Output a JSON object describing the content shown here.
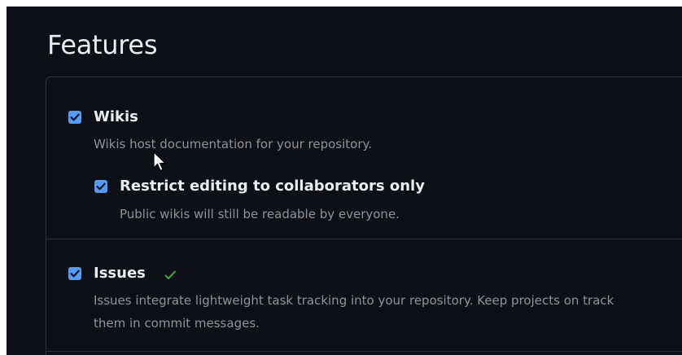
{
  "section": {
    "title": "Features"
  },
  "features": {
    "wikis": {
      "label": "Wikis",
      "checked": true,
      "description": "Wikis host documentation for your repository."
    },
    "restrict_editing": {
      "label": "Restrict editing to collaborators only",
      "checked": true,
      "description": "Public wikis will still be readable by everyone."
    },
    "issues": {
      "label": "Issues",
      "checked": true,
      "status_icon": "checkmark-icon",
      "description_line1": "Issues integrate lightweight task tracking into your repository. Keep projects on track",
      "description_line2": "them in commit messages."
    }
  },
  "colors": {
    "background": "#0d1117",
    "checkbox": "#539bf5",
    "success": "#3fb950",
    "text": "#e6edf3",
    "muted": "#8b949e",
    "border": "#30363d"
  }
}
